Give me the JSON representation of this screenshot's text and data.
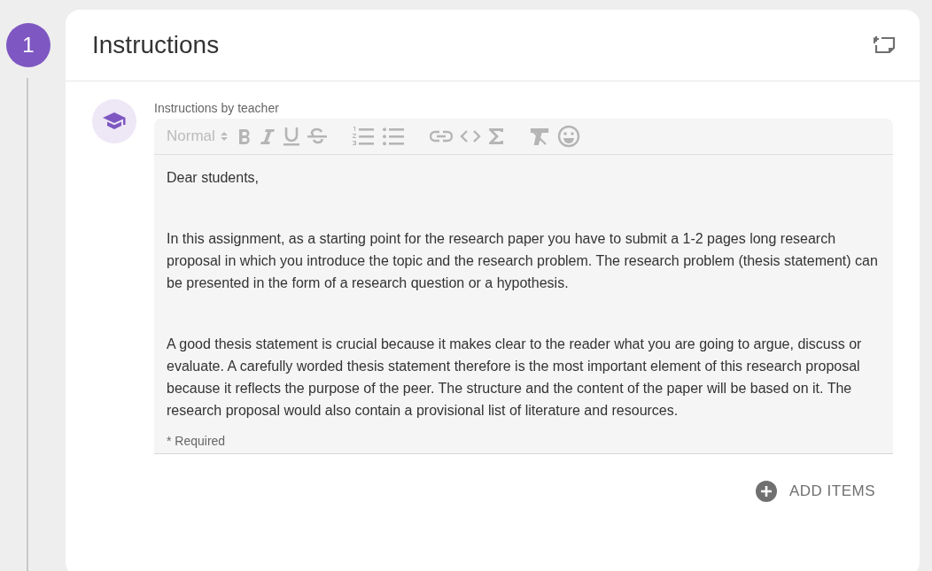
{
  "step": {
    "number": "1"
  },
  "card": {
    "title": "Instructions"
  },
  "editor": {
    "label": "Instructions by teacher",
    "format": "Normal",
    "paragraphs": [
      "Dear students,",
      "In this assignment, as a starting point for the research paper you have to submit a 1-2 pages long research proposal in which you introduce the topic and the research problem. The research problem (thesis statement) can be presented in the form of a research question or a hypothesis.",
      "A good thesis statement is crucial because it makes clear to the reader what you are going to argue, discuss or evaluate. A carefully worded thesis statement therefore is the most important element of this research proposal because it reflects the purpose of the peer. The structure and the content of the paper will be based on it. The research proposal would also contain a provisional list of literature and resources."
    ],
    "required_note": "* Required"
  },
  "add_button": {
    "label": "ADD ITEMS"
  }
}
